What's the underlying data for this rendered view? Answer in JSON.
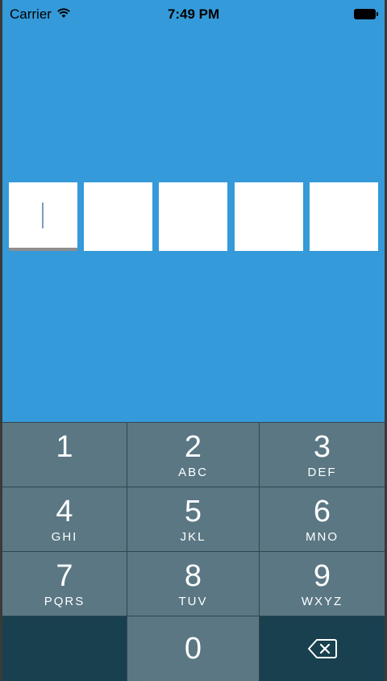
{
  "status": {
    "carrier": "Carrier",
    "time": "7:49 PM",
    "wifi_icon": "wifi-icon",
    "battery_icon": "battery-icon"
  },
  "code_input": {
    "boxes": [
      "",
      "",
      "",
      "",
      ""
    ],
    "active_index": 0
  },
  "keypad": {
    "keys": [
      {
        "digit": "1",
        "letters": ""
      },
      {
        "digit": "2",
        "letters": "ABC"
      },
      {
        "digit": "3",
        "letters": "DEF"
      },
      {
        "digit": "4",
        "letters": "GHI"
      },
      {
        "digit": "5",
        "letters": "JKL"
      },
      {
        "digit": "6",
        "letters": "MNO"
      },
      {
        "digit": "7",
        "letters": "PQRS"
      },
      {
        "digit": "8",
        "letters": "TUV"
      },
      {
        "digit": "9",
        "letters": "WXYZ"
      },
      {
        "digit": "0",
        "letters": ""
      }
    ],
    "delete_icon": "backspace-icon"
  },
  "colors": {
    "background": "#359ad9",
    "key": "#5a7783",
    "key_dark": "#18404f"
  }
}
